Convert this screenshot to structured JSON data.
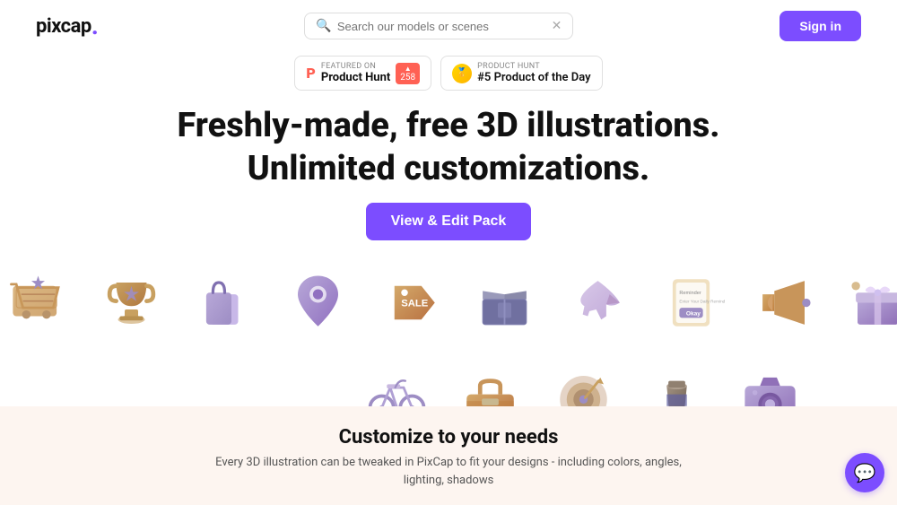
{
  "header": {
    "logo_text": "pixcap",
    "logo_dot": ".",
    "search_placeholder": "Search our models or scenes",
    "sign_in_label": "Sign in"
  },
  "badges": [
    {
      "id": "product-hunt",
      "top_label": "FEATURED ON",
      "name": "Product Hunt",
      "count": "258",
      "type": "ph"
    },
    {
      "id": "product-of-day",
      "top_label": "PRODUCT HUNT",
      "name": "#5 Product of the Day",
      "type": "medal"
    }
  ],
  "hero": {
    "headline_line1": "Freshly-made, free 3D illustrations.",
    "headline_line2": "Unlimited customizations.",
    "cta_label": "View & Edit Pack"
  },
  "icons_row1": [
    {
      "name": "cart",
      "emoji": "🛒"
    },
    {
      "name": "trophy",
      "emoji": "🏆"
    },
    {
      "name": "shopping-bag",
      "emoji": "🛍"
    },
    {
      "name": "location-pin",
      "emoji": "📍"
    },
    {
      "name": "sale-tag",
      "emoji": "🏷"
    },
    {
      "name": "box",
      "emoji": "📦"
    },
    {
      "name": "airplane",
      "emoji": "✈️"
    },
    {
      "name": "reminder",
      "emoji": "📋"
    },
    {
      "name": "megaphone",
      "emoji": "📣"
    },
    {
      "name": "gift",
      "emoji": "🎁"
    }
  ],
  "icons_row2": [
    {
      "name": "bicycle",
      "emoji": "🚲"
    },
    {
      "name": "toolbox",
      "emoji": "🧰"
    },
    {
      "name": "target",
      "emoji": "🎯"
    },
    {
      "name": "coffee",
      "emoji": "☕"
    },
    {
      "name": "camera",
      "emoji": "📷"
    }
  ],
  "bottom": {
    "title": "Customize to your needs",
    "description_line1": "Every 3D illustration can be tweaked in PixCap to fit your designs - including colors, angles,",
    "description_line2": "lighting, shadows"
  },
  "chat": {
    "icon": "💬"
  }
}
